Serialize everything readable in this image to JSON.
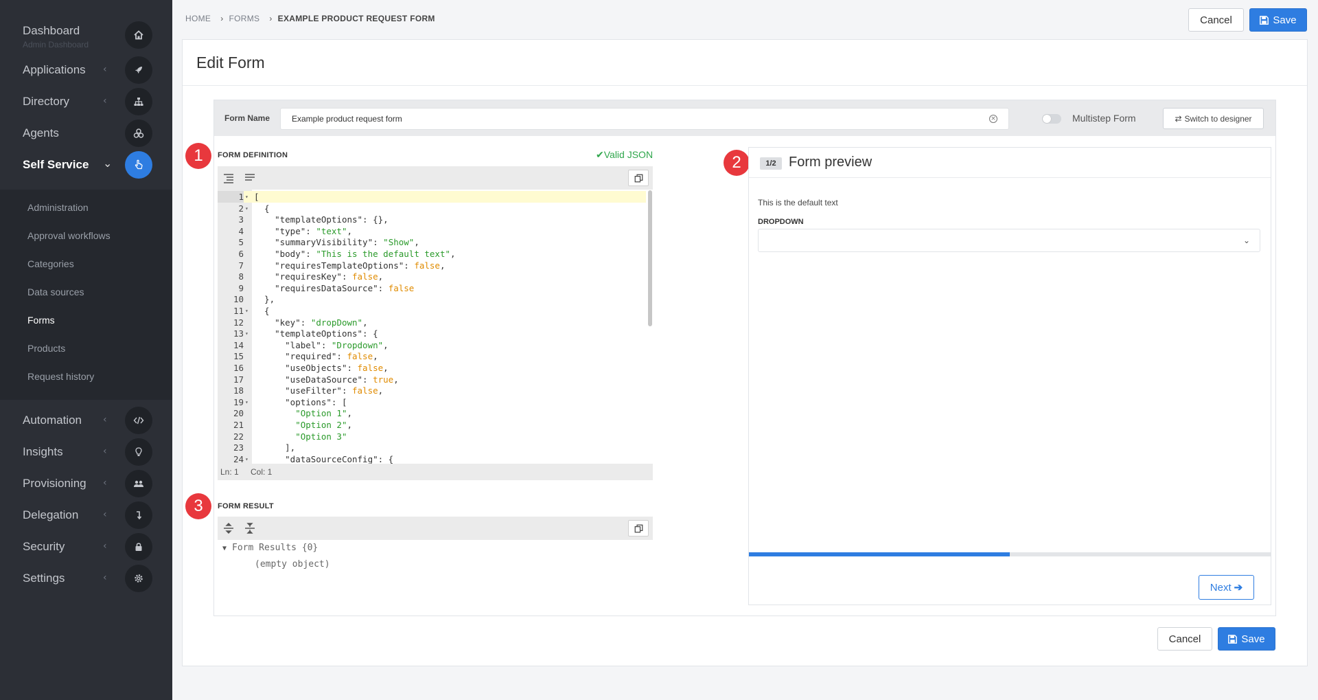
{
  "breadcrumb": {
    "home": "HOME",
    "forms": "FORMS",
    "current": "EXAMPLE PRODUCT REQUEST FORM"
  },
  "top_actions": {
    "cancel": "Cancel",
    "save": "Save"
  },
  "sidebar": {
    "dashboard": {
      "label": "Dashboard",
      "sub": "Admin Dashboard"
    },
    "items": [
      {
        "label": "Applications",
        "icon": "rocket-icon"
      },
      {
        "label": "Directory",
        "icon": "sitemap-icon"
      },
      {
        "label": "Agents",
        "icon": "agents-icon"
      },
      {
        "label": "Self Service",
        "icon": "hand-pointer-icon"
      }
    ],
    "submenu": [
      "Administration",
      "Approval workflows",
      "Categories",
      "Data sources",
      "Forms",
      "Products",
      "Request history"
    ],
    "bottom_items": [
      {
        "label": "Automation",
        "icon": "code-icon"
      },
      {
        "label": "Insights",
        "icon": "lightbulb-icon"
      },
      {
        "label": "Provisioning",
        "icon": "users-icon"
      },
      {
        "label": "Delegation",
        "icon": "level-down-icon"
      },
      {
        "label": "Security",
        "icon": "lock-icon"
      },
      {
        "label": "Settings",
        "icon": "gear-icon"
      }
    ]
  },
  "page": {
    "title": "Edit Form"
  },
  "form_name": {
    "label": "Form Name",
    "value": "Example product request form"
  },
  "multistep": {
    "label": "Multistep Form",
    "enabled": false
  },
  "switch_designer": "Switch to designer",
  "badges": {
    "one": "1",
    "two": "2",
    "three": "3"
  },
  "definition": {
    "label": "FORM DEFINITION",
    "valid": "Valid JSON",
    "lines": [
      "[",
      "  {",
      "    \"templateOptions\": {},",
      "    \"type\": \"text\",",
      "    \"summaryVisibility\": \"Show\",",
      "    \"body\": \"This is the default text\",",
      "    \"requiresTemplateOptions\": false,",
      "    \"requiresKey\": false,",
      "    \"requiresDataSource\": false",
      "  },",
      "  {",
      "    \"key\": \"dropDown\",",
      "    \"templateOptions\": {",
      "      \"label\": \"Dropdown\",",
      "      \"required\": false,",
      "      \"useObjects\": false,",
      "      \"useDataSource\": true,",
      "      \"useFilter\": false,",
      "      \"options\": [",
      "        \"Option 1\",",
      "        \"Option 2\",",
      "        \"Option 3\"",
      "      ],",
      "      \"dataSourceConfig\": {"
    ],
    "fold_lines": [
      1,
      2,
      11,
      13,
      19,
      24
    ],
    "status": {
      "ln": "Ln: 1",
      "col": "Col: 1"
    }
  },
  "result": {
    "label": "FORM RESULT",
    "root": "Form Results {0}",
    "empty": "(empty object)"
  },
  "preview": {
    "step": "1/2",
    "title": "Form preview",
    "text": "This is the default text",
    "dropdown_label": "DROPDOWN",
    "progress": 0.5,
    "next": "Next"
  },
  "bottom_actions": {
    "cancel": "Cancel",
    "save": "Save"
  },
  "colors": {
    "accent": "#2e7de1",
    "sidebar": "#2c2f36",
    "badge": "#e8383d",
    "valid": "#2ea64b"
  }
}
